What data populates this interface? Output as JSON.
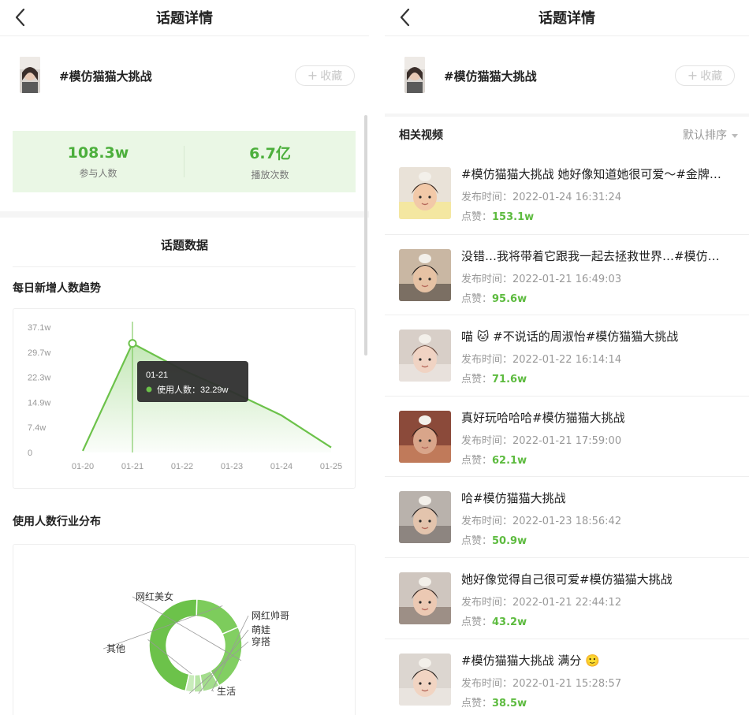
{
  "left_screen": {
    "nav": {
      "title": "话题详情"
    },
    "topic": {
      "name": "#模仿猫猫大挑战",
      "fav_label": "收藏",
      "fav_plus": "+"
    },
    "stats": [
      {
        "value": "108.3w",
        "label": "参与人数"
      },
      {
        "value": "6.7亿",
        "label": "播放次数"
      }
    ],
    "section_title": "话题数据",
    "trend_title": "每日新增人数趋势",
    "dist_title": "使用人数行业分布"
  },
  "right_screen": {
    "nav": {
      "title": "话题详情"
    },
    "topic": {
      "name": "#模仿猫猫大挑战",
      "fav_label": "收藏",
      "fav_plus": "+"
    },
    "list_title": "相关视频",
    "sort_label": "默认排序",
    "videos": [
      {
        "title": "#模仿猫猫大挑战 她好像知道她很可爱～#金牌…",
        "date_label": "发布时间：",
        "date": "2022-01-24 16:31:24",
        "likes_label": "点赞：",
        "likes": "153.1w"
      },
      {
        "title": "没错…我将带着它跟我一起去拯救世界…#模仿…",
        "date_label": "发布时间：",
        "date": "2022-01-21 16:49:03",
        "likes_label": "点赞：",
        "likes": "95.6w"
      },
      {
        "title": "喵 🐱 #不说话的周淑怡#模仿猫猫大挑战",
        "date_label": "发布时间：",
        "date": "2022-01-22 16:14:14",
        "likes_label": "点赞：",
        "likes": "71.6w"
      },
      {
        "title": "真好玩哈哈哈#模仿猫猫大挑战",
        "date_label": "发布时间：",
        "date": "2022-01-21 17:59:00",
        "likes_label": "点赞：",
        "likes": "62.1w"
      },
      {
        "title": "哈#模仿猫猫大挑战",
        "date_label": "发布时间：",
        "date": "2022-01-23 18:56:42",
        "likes_label": "点赞：",
        "likes": "50.9w"
      },
      {
        "title": "她好像觉得自己很可爱#模仿猫猫大挑战",
        "date_label": "发布时间：",
        "date": "2022-01-21 22:44:12",
        "likes_label": "点赞：",
        "likes": "43.2w"
      },
      {
        "title": "#模仿猫猫大挑战 满分 🙂",
        "date_label": "发布时间：",
        "date": "2022-01-21 15:28:57",
        "likes_label": "点赞：",
        "likes": "38.5w"
      }
    ]
  },
  "colors": {
    "accent": "#5dbb3f",
    "accent_dark": "#4caf3c",
    "stats_bg": "#eaf7e5",
    "tooltip_bg": "#2f2f2f"
  },
  "chart_data": [
    {
      "type": "area",
      "x": [
        "01-20",
        "01-21",
        "01-22",
        "01-23",
        "01-24",
        "01-25"
      ],
      "values": [
        0.5,
        32.29,
        24.5,
        18.0,
        11.0,
        1.5
      ],
      "y_ticks": [
        "0",
        "7.4w",
        "14.9w",
        "22.3w",
        "29.7w",
        "37.1w"
      ],
      "ylim": [
        0,
        37.1
      ],
      "unit": "w",
      "tooltip": {
        "x": "01-21",
        "label": "使用人数：",
        "value": "32.29w"
      }
    },
    {
      "type": "pie",
      "style": "donut",
      "slices": [
        {
          "name": "生活",
          "value": 47
        },
        {
          "name": "其他",
          "value": 18
        },
        {
          "name": "网红美女",
          "value": 23
        },
        {
          "name": "网红帅哥",
          "value": 6
        },
        {
          "name": "萌娃",
          "value": 3
        },
        {
          "name": "穿搭",
          "value": 3
        }
      ]
    }
  ]
}
